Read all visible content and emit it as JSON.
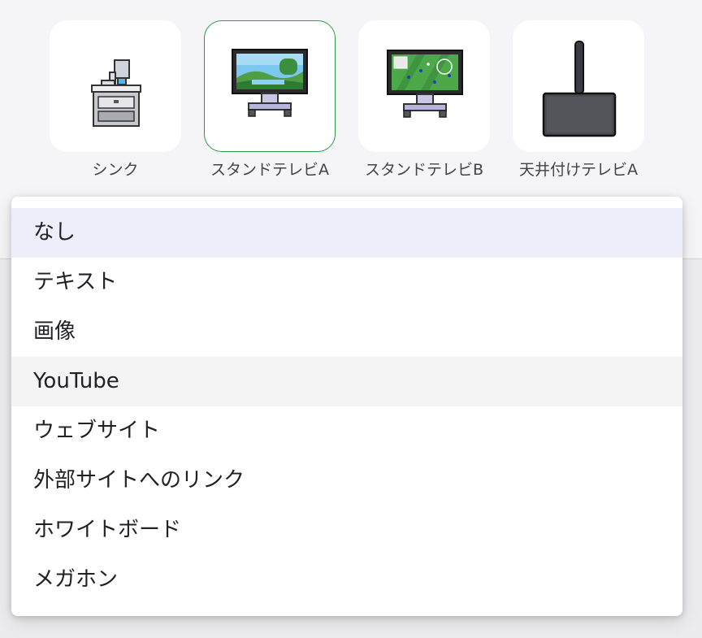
{
  "furniture": [
    {
      "label": "シンク",
      "icon": "sink-icon",
      "selected": false
    },
    {
      "label": "スタンドテレビA",
      "icon": "stand-tv-landscape-icon",
      "selected": true
    },
    {
      "label": "スタンドテレビB",
      "icon": "stand-tv-soccer-icon",
      "selected": false
    },
    {
      "label": "天井付けテレビA",
      "icon": "ceiling-tv-icon",
      "selected": false
    }
  ],
  "menu": {
    "items": [
      {
        "label": "なし",
        "state": "selected"
      },
      {
        "label": "テキスト",
        "state": ""
      },
      {
        "label": "画像",
        "state": ""
      },
      {
        "label": "YouTube",
        "state": "hover"
      },
      {
        "label": "ウェブサイト",
        "state": ""
      },
      {
        "label": "外部サイトへのリンク",
        "state": ""
      },
      {
        "label": "ホワイトボード",
        "state": ""
      },
      {
        "label": "メガホン",
        "state": ""
      }
    ]
  },
  "colors": {
    "selected_border": "#2e9a45",
    "active_item_bg": "#eeeefb",
    "hover_item_bg": "#f4f4f5",
    "page_bg": "#f5f5f7"
  }
}
